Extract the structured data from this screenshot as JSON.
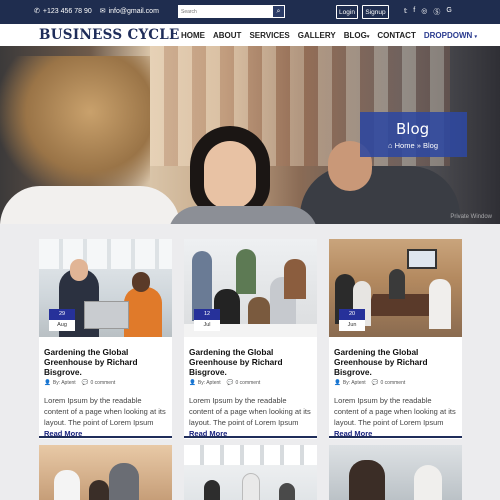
{
  "topbar": {
    "phone": "+123 456 78 90",
    "email": "info@gmail.com",
    "search_placeholder": "Search",
    "login_label": "Login",
    "signup_label": "Signup",
    "social_icons": [
      "twitter-icon",
      "facebook-icon",
      "instagram-icon",
      "skype-icon",
      "google-plus-icon"
    ]
  },
  "nav": {
    "brand": "BUSINESS CYCLE",
    "items": [
      "HOME",
      "ABOUT",
      "SERVICES",
      "GALLERY",
      "BLOG",
      "CONTACT",
      "DROPDOWN"
    ]
  },
  "hero": {
    "title": "Blog",
    "breadcrumb_home": "Home",
    "breadcrumb_sep": "»",
    "breadcrumb_current": "Blog",
    "watermark": "Private Window"
  },
  "cards": [
    {
      "day": "29",
      "month": "Aug",
      "title": "Gardening the Global Greenhouse by Richard Bisgrove.",
      "author": "By: Aptent",
      "comments": "0 comment",
      "excerpt": "Lorem Ipsum by the readable content of a page when looking at its layout. The point of Lorem Ipsum",
      "more": "Read More"
    },
    {
      "day": "12",
      "month": "Jul",
      "title": "Gardening the Global Greenhouse by Richard Bisgrove.",
      "author": "By: Aptent",
      "comments": "0 comment",
      "excerpt": "Lorem Ipsum by the readable content of a page when looking at its layout. The point of Lorem Ipsum",
      "more": "Read More"
    },
    {
      "day": "20",
      "month": "Jun",
      "title": "Gardening the Global Greenhouse by Richard Bisgrove.",
      "author": "By: Aptent",
      "comments": "0 comment",
      "excerpt": "Lorem Ipsum by the readable content of a page when looking at its layout. The point of Lorem Ipsum",
      "more": "Read More"
    }
  ],
  "colors": {
    "topbar_bg": "#1f2d4f",
    "brand": "#1f2d5a",
    "accent": "#26319a",
    "page_bg": "#ececee"
  }
}
